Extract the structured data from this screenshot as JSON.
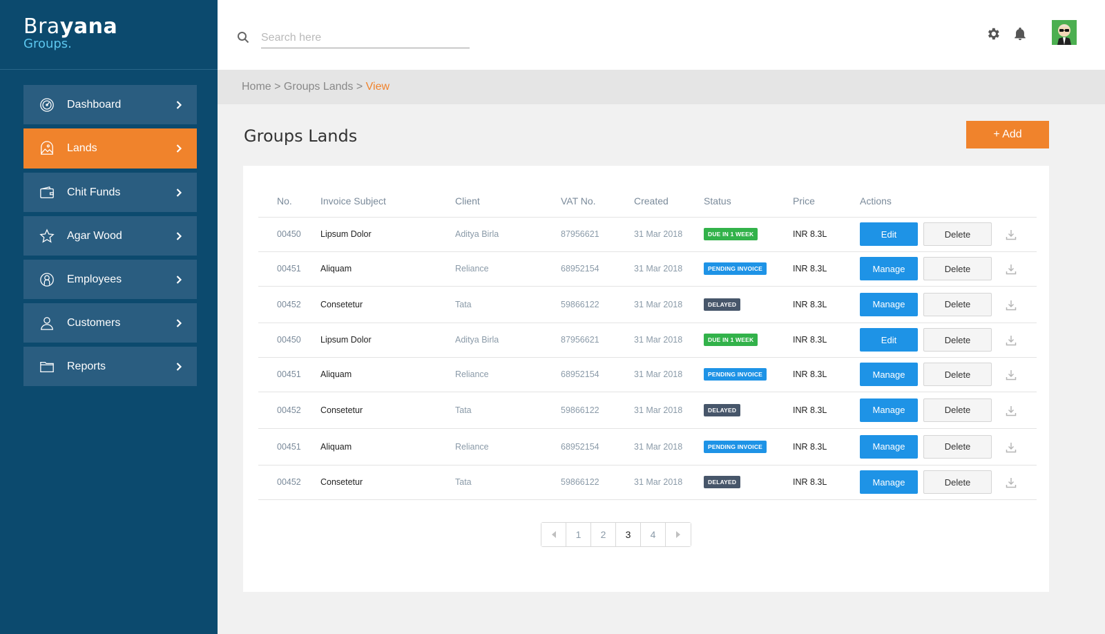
{
  "brand": {
    "name_light": "Bra",
    "name_bold": "yana",
    "subtitle": "Groups."
  },
  "sidebar": {
    "items": [
      {
        "label": "Dashboard",
        "icon": "speedometer-icon",
        "active": false
      },
      {
        "label": "Lands",
        "icon": "landscape-icon",
        "active": true
      },
      {
        "label": "Chit Funds",
        "icon": "wallet-icon",
        "active": false
      },
      {
        "label": "Agar Wood",
        "icon": "star-icon",
        "active": false
      },
      {
        "label": "Employees",
        "icon": "user-circle-icon",
        "active": false
      },
      {
        "label": "Customers",
        "icon": "person-icon",
        "active": false
      },
      {
        "label": "Reports",
        "icon": "folder-icon",
        "active": false
      }
    ]
  },
  "header": {
    "search_placeholder": "Search here",
    "search_value": "",
    "icons": [
      "search-icon",
      "gear-icon",
      "bell-icon",
      "avatar"
    ]
  },
  "breadcrumb": {
    "home": "Home",
    "sep1": " > ",
    "section": "Groups Lands",
    "sep2": " > ",
    "current": "View"
  },
  "page": {
    "title": "Groups Lands",
    "add_label": "+ Add"
  },
  "table": {
    "headers": [
      "No.",
      "Invoice Subject",
      "Client",
      "VAT No.",
      "Created",
      "Status",
      "Price",
      "Actions"
    ],
    "rows": [
      {
        "no": "00450",
        "subject": "Lipsum Dolor",
        "client": "Aditya Birla",
        "vat": "87956621",
        "created": "31 Mar 2018",
        "status": "DUE IN 1 WEEK",
        "price": "INR 8.3L",
        "action": "Edit",
        "delete": "Delete"
      },
      {
        "no": "00451",
        "subject": "Aliquam",
        "client": "Reliance",
        "vat": "68952154",
        "created": "31 Mar 2018",
        "status": "PENDING INVOICE",
        "price": "INR 8.3L",
        "action": "Manage",
        "delete": "Delete"
      },
      {
        "no": "00452",
        "subject": "Consetetur",
        "client": "Tata",
        "vat": "59866122",
        "created": "31 Mar 2018",
        "status": "DELAYED",
        "price": "INR 8.3L",
        "action": "Manage",
        "delete": "Delete"
      },
      {
        "no": "00450",
        "subject": "Lipsum Dolor",
        "client": "Aditya Birla",
        "vat": "87956621",
        "created": "31 Mar 2018",
        "status": "DUE IN 1 WEEK",
        "price": "INR 8.3L",
        "action": "Edit",
        "delete": "Delete"
      },
      {
        "no": "00451",
        "subject": "Aliquam",
        "client": "Reliance",
        "vat": "68952154",
        "created": "31 Mar 2018",
        "status": "PENDING INVOICE",
        "price": "INR 8.3L",
        "action": "Manage",
        "delete": "Delete"
      },
      {
        "no": "00452",
        "subject": "Consetetur",
        "client": "Tata",
        "vat": "59866122",
        "created": "31 Mar 2018",
        "status": "DELAYED",
        "price": "INR 8.3L",
        "action": "Manage",
        "delete": "Delete"
      },
      {
        "no": "00451",
        "subject": "Aliquam",
        "client": "Reliance",
        "vat": "68952154",
        "created": "31 Mar 2018",
        "status": "PENDING INVOICE",
        "price": "INR 8.3L",
        "action": "Manage",
        "delete": "Delete"
      },
      {
        "no": "00452",
        "subject": "Consetetur",
        "client": "Tata",
        "vat": "59866122",
        "created": "31 Mar 2018",
        "status": "DELAYED",
        "price": "INR 8.3L",
        "action": "Manage",
        "delete": "Delete"
      }
    ]
  },
  "status_colors": {
    "DUE IN 1 WEEK": "#32b24a",
    "PENDING INVOICE": "#1e93e6",
    "DELAYED": "#47566a"
  },
  "pagination": {
    "pages": [
      "1",
      "2",
      "3",
      "4"
    ],
    "current": "3"
  },
  "colors": {
    "sidebar": "#0c4a6e",
    "accent": "#f0832c",
    "primary": "#1e93e6"
  }
}
